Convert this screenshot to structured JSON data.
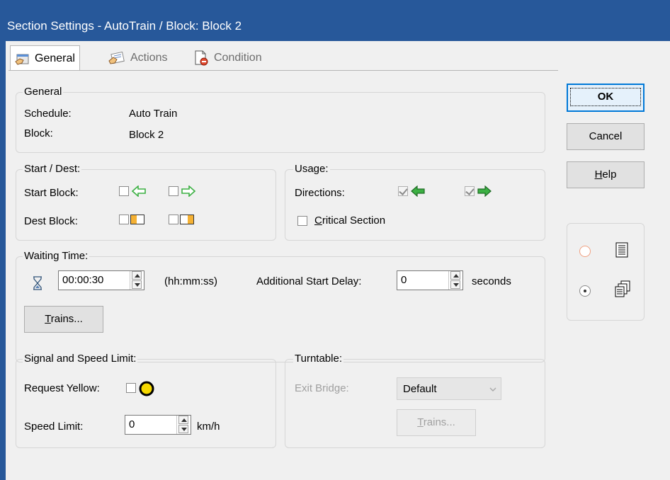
{
  "window": {
    "title": "Section Settings - AutoTrain / Block: Block 2"
  },
  "tabs": [
    {
      "label": "General",
      "icon": "hand-properties-icon",
      "active": true
    },
    {
      "label": "Actions",
      "icon": "actions-icon",
      "active": false
    },
    {
      "label": "Condition",
      "icon": "condition-icon",
      "active": false
    }
  ],
  "general": {
    "group_label": "General",
    "schedule_label": "Schedule:",
    "schedule_value": "Auto Train",
    "block_label": "Block:",
    "block_value": "Block 2"
  },
  "start_dest": {
    "group_label": "Start / Dest:",
    "start_label": "Start Block:",
    "dest_label": "Dest Block:"
  },
  "usage": {
    "group_label": "Usage:",
    "directions_label": "Directions:",
    "critical_label_u": "C",
    "critical_label_rest": "ritical Section"
  },
  "waiting": {
    "group_label": "Waiting Time:",
    "time_value": "00:00:30",
    "time_format": "(hh:mm:ss)",
    "delay_label": "Additional Start Delay:",
    "delay_value": "0",
    "delay_unit": "seconds",
    "trains_u": "T",
    "trains_rest": "rains..."
  },
  "signal": {
    "group_label": "Signal and Speed Limit:",
    "yellow_label": "Request Yellow:",
    "speed_label": "Speed Limit:",
    "speed_value": "0",
    "speed_unit": "km/h"
  },
  "turntable": {
    "group_label": "Turntable:",
    "exit_label": "Exit Bridge:",
    "exit_value": "Default",
    "trains_u": "T",
    "trains_rest": "rains..."
  },
  "buttons": {
    "ok": "OK",
    "cancel": "Cancel",
    "help_u": "H",
    "help_rest": "elp"
  },
  "colors": {
    "titlebar": "#27589a",
    "arrow_green": "#3cb043",
    "block_fill": "#f5b133",
    "signal_yellow": "#f5d800"
  }
}
